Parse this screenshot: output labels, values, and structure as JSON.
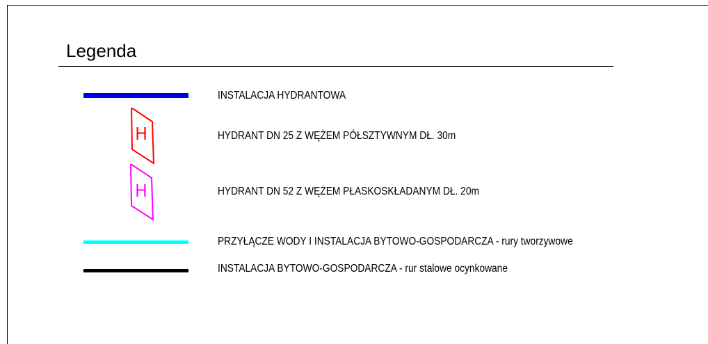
{
  "legend": {
    "title": "Legenda",
    "items": [
      {
        "symbol": "line",
        "color": "#0000e0",
        "label": "INSTALACJA HYDRANTOWA"
      },
      {
        "symbol": "hydrant",
        "color": "#ff0000",
        "letter": "H",
        "label": "HYDRANT DN 25 Z WĘŻEM PÓŁSZTYWNYM DŁ. 30m"
      },
      {
        "symbol": "hydrant",
        "color": "#ff00ff",
        "letter": "H",
        "label": "HYDRANT DN 52 Z WĘŻEM PŁASKOSKŁADANYM DŁ. 20m"
      },
      {
        "symbol": "line",
        "color": "#00ffff",
        "label": "PRZYŁĄCZE WODY I INSTALACJA BYTOWO-GOSPODARCZA - rury tworzywowe"
      },
      {
        "symbol": "line",
        "color": "#000000",
        "label": "INSTALACJA BYTOWO-GOSPODARCZA - rur stalowe ocynkowane"
      }
    ]
  }
}
